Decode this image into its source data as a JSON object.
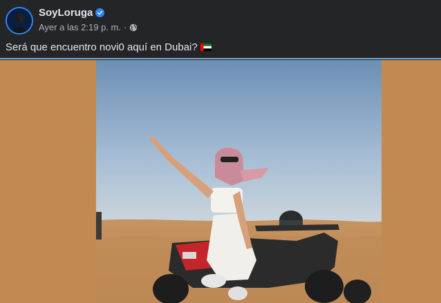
{
  "post": {
    "author": "SoyLoruga",
    "timestamp": "Ayer a las 2:19 p. m.",
    "separator": "·",
    "caption": "Será que encuentro novi0 aquí en Dubai?",
    "flag_icon": "uae-flag-icon",
    "privacy_icon": "globe-icon",
    "verified_icon": "verified-badge-icon"
  },
  "colors": {
    "background": "#242526",
    "text": "#e4e6eb",
    "muted": "#b0b3b8",
    "verified": "#2d88ff",
    "media_fill": "#c18a52"
  }
}
